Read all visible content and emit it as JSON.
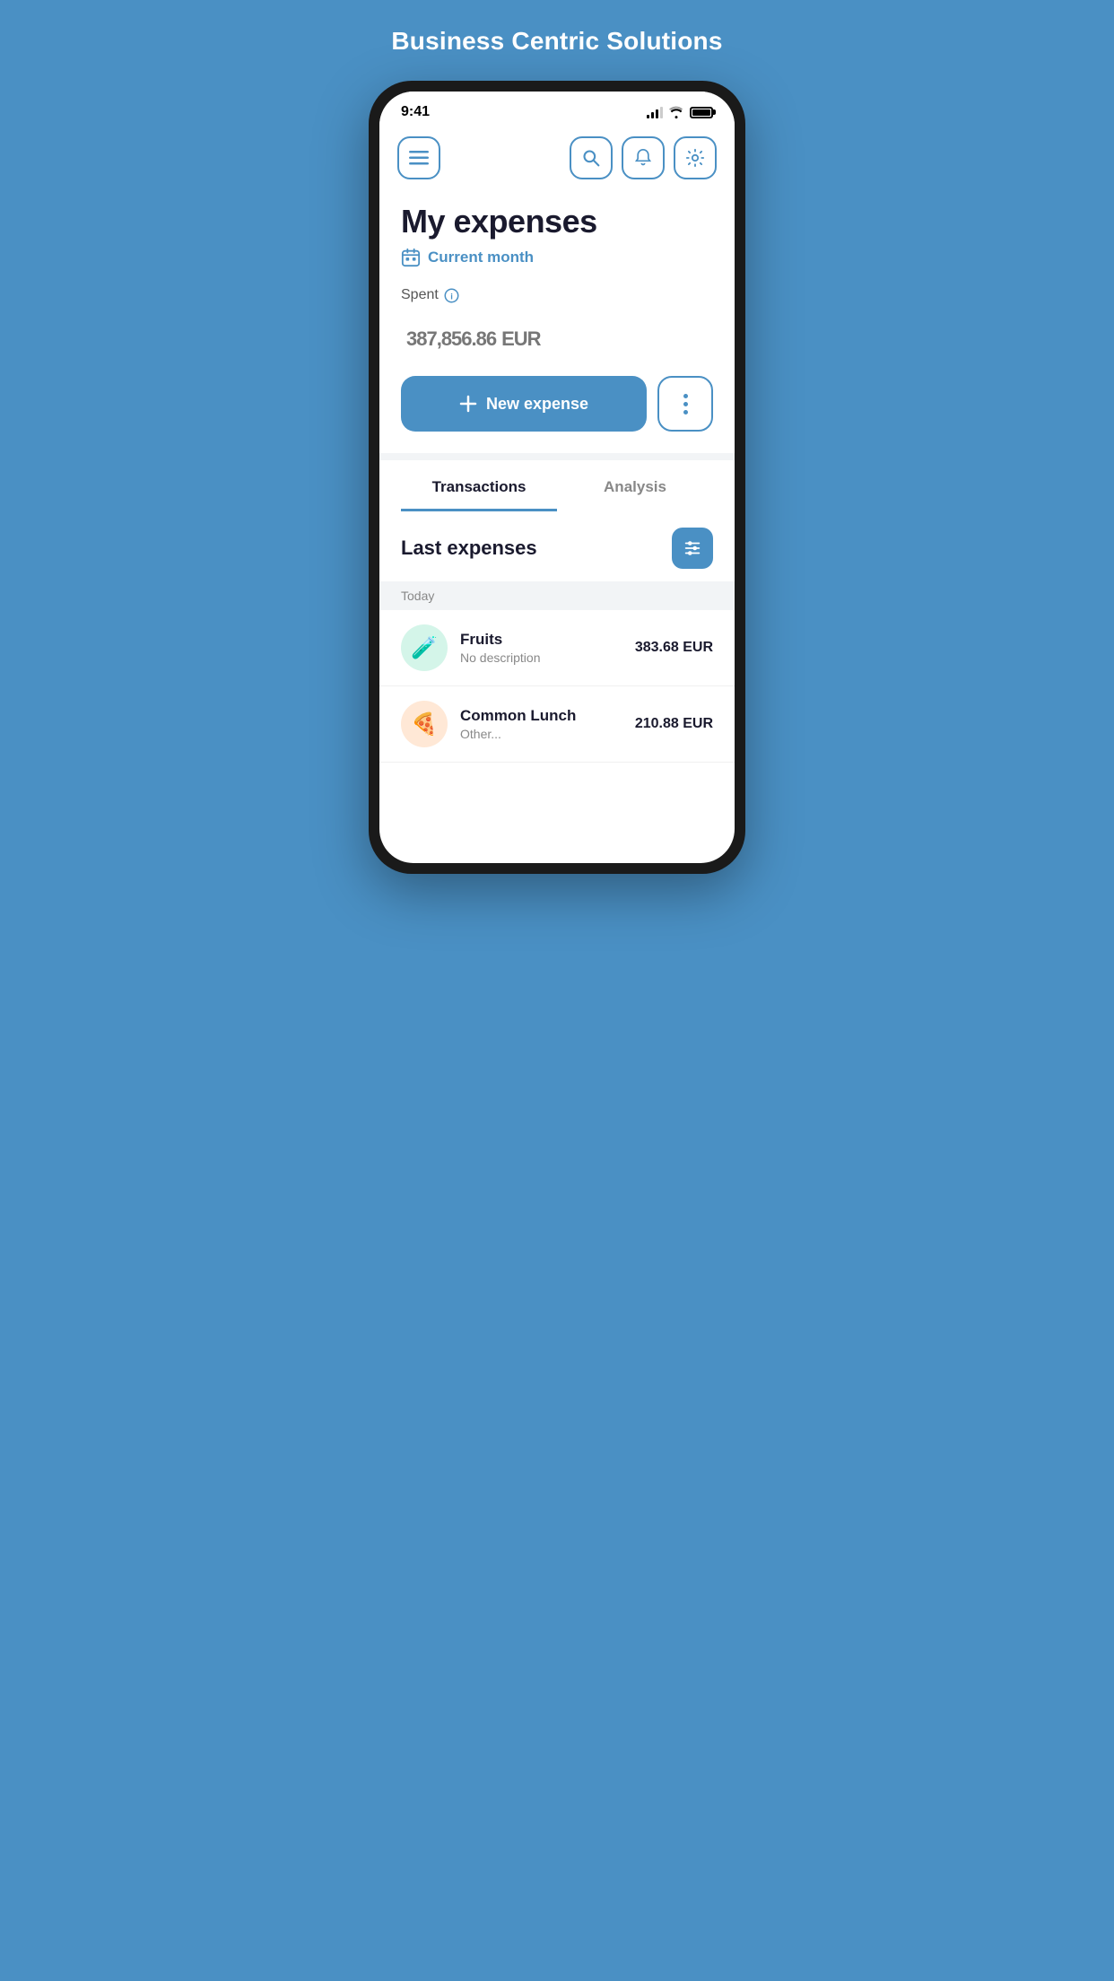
{
  "app": {
    "title": "Business Centric Solutions"
  },
  "status_bar": {
    "time": "9:41"
  },
  "nav": {
    "menu_label": "Menu",
    "search_label": "Search",
    "notifications_label": "Notifications",
    "settings_label": "Settings"
  },
  "page": {
    "title": "My expenses",
    "date_filter": "Current month",
    "spent_label": "Spent",
    "amount": "387,856.86",
    "currency": "EUR",
    "new_expense_btn": "New expense"
  },
  "tabs": [
    {
      "label": "Transactions",
      "active": true
    },
    {
      "label": "Analysis",
      "active": false
    }
  ],
  "last_expenses": {
    "title": "Last expenses",
    "sections": [
      {
        "date": "Today",
        "items": [
          {
            "name": "Fruits",
            "description": "No description",
            "amount": "383.68 EUR",
            "icon": "🧪",
            "icon_bg": "#d4f5e9"
          },
          {
            "name": "Common Lunch",
            "description": "Other...",
            "amount": "210.88 EUR",
            "icon": "🍕",
            "icon_bg": "#ffe8d6"
          }
        ]
      }
    ]
  }
}
